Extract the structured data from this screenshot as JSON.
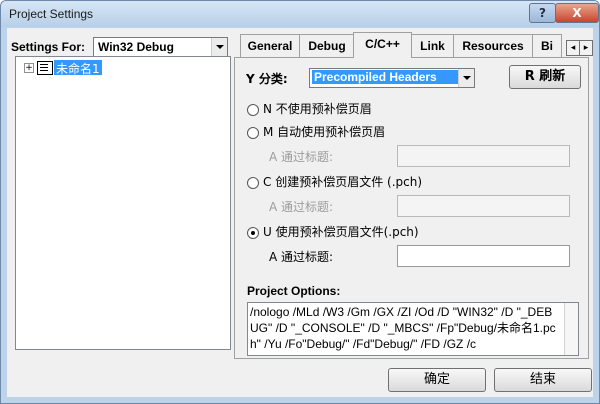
{
  "window": {
    "title": "Project Settings",
    "help_label": "?",
    "close_label": "X"
  },
  "settings_for": {
    "label": "Settings For:",
    "selected": "Win32 Debug"
  },
  "tree": {
    "expander": "+",
    "item": "未命名1"
  },
  "tabs": [
    {
      "label": "General"
    },
    {
      "label": "Debug"
    },
    {
      "label": "C/C++"
    },
    {
      "label": "Link"
    },
    {
      "label": "Resources"
    },
    {
      "label": "Bi"
    }
  ],
  "tab_scroll": {
    "left": "◂",
    "right": "▸"
  },
  "category": {
    "label": "Y 分类:",
    "selected": "Precompiled Headers",
    "refresh_label": "R 刷新"
  },
  "options": [
    {
      "label": "N 不使用预补偿页眉"
    },
    {
      "label": "M 自动使用预补偿页眉"
    },
    {
      "label": "C 创建预补偿页眉文件 (.pch)"
    },
    {
      "label": "U 使用预补偿页眉文件(.pch)"
    }
  ],
  "through_header_label": "A 通过标题:",
  "project_options": {
    "label": "Project Options:",
    "text": "/nologo /MLd /W3 /Gm /GX /ZI /Od /D \"WIN32\" /D \"_DEBUG\" /D \"_CONSOLE\" /D \"_MBCS\" /Fp\"Debug/未命名1.pch\" /Yu /Fo\"Debug/\" /Fd\"Debug/\" /FD /GZ /c"
  },
  "buttons": {
    "ok": "确定",
    "cancel": "结束"
  }
}
